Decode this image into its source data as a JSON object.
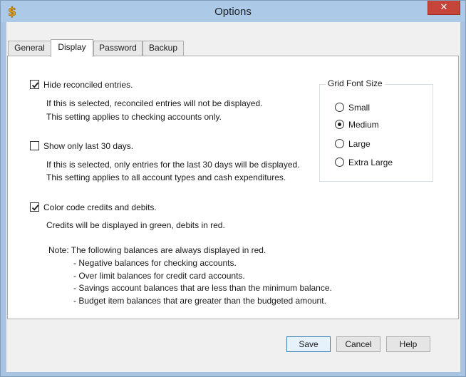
{
  "window": {
    "title": "Options",
    "close_glyph": "✕"
  },
  "tabs": [
    {
      "label": "General",
      "active": false
    },
    {
      "label": "Display",
      "active": true
    },
    {
      "label": "Password",
      "active": false
    },
    {
      "label": "Backup",
      "active": false
    }
  ],
  "display": {
    "hide_reconciled": {
      "label": "Hide reconciled entries.",
      "checked": true,
      "desc1": "If this is selected, reconciled entries will not be displayed.",
      "desc2": "This setting applies to checking accounts only."
    },
    "show_last_30": {
      "label": "Show only last 30 days.",
      "checked": false,
      "desc1": "If this is selected, only entries for the last 30 days will be displayed.",
      "desc2": "This setting applies to all account types and cash expenditures."
    },
    "color_code": {
      "label": "Color code credits and debits.",
      "checked": true,
      "desc1": "Credits will be displayed in green, debits in red."
    },
    "note": {
      "heading": "Note:  The following balances are always displayed in red.",
      "items": [
        "- Negative balances for checking accounts.",
        "- Over limit balances for credit card accounts.",
        "- Savings account balances that are less than the minimum balance.",
        "- Budget item balances that are greater than the budgeted amount."
      ]
    },
    "grid_font": {
      "title": "Grid Font Size",
      "options": [
        "Small",
        "Medium",
        "Large",
        "Extra Large"
      ],
      "selected": "Medium"
    }
  },
  "buttons": {
    "save": "Save",
    "cancel": "Cancel",
    "help": "Help"
  },
  "colors": {
    "close": "#c7443a",
    "titlebar": "#adc9e8",
    "app_icon": "#e8a317"
  }
}
